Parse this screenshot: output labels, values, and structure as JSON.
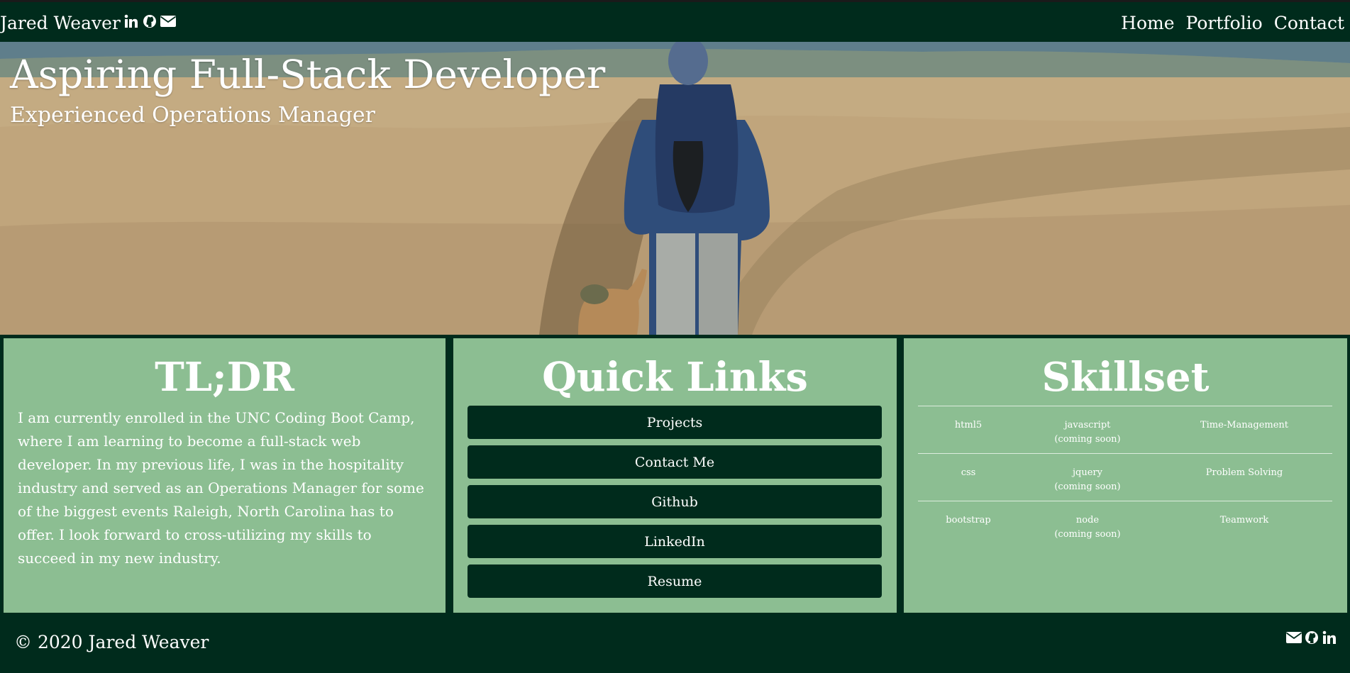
{
  "navbar": {
    "brand": "Jared Weaver",
    "social_icons": [
      "linkedin-icon",
      "github-icon",
      "envelope-icon"
    ],
    "links": [
      "Home",
      "Portfolio",
      "Contact"
    ]
  },
  "hero": {
    "title": "Aspiring Full-Stack Developer",
    "subtitle": "Experienced Operations Manager"
  },
  "tldr": {
    "title": "TL;DR",
    "text": "I am currently enrolled in the UNC Coding Boot Camp, where I am learning to become a full-stack web developer. In my previous life, I was in the hospitality industry and served as an Operations Manager for some of the biggest events Raleigh, North Carolina has to offer. I look forward to cross-utilizing my skills to succeed in my new industry."
  },
  "quick_links": {
    "title": "Quick Links",
    "buttons": [
      "Projects",
      "Contact Me",
      "Github",
      "LinkedIn",
      "Resume"
    ]
  },
  "skillset": {
    "title": "Skillset",
    "rows": [
      {
        "col1": "html5",
        "col2": "javascript",
        "col2_note": "(coming soon)",
        "col3": "Time-Management"
      },
      {
        "col1": "css",
        "col2": "jquery",
        "col2_note": "(coming soon)",
        "col3": "Problem Solving"
      },
      {
        "col1": "bootstrap",
        "col2": "node",
        "col2_note": "(coming soon)",
        "col3": "Teamwork"
      }
    ]
  },
  "footer": {
    "copyright": "© 2020 Jared Weaver",
    "social_icons": [
      "envelope-icon",
      "github-icon",
      "linkedin-icon"
    ]
  },
  "colors": {
    "dark_green": "#002b1c",
    "card_green": "#8cbe92",
    "text": "#ffffff"
  }
}
